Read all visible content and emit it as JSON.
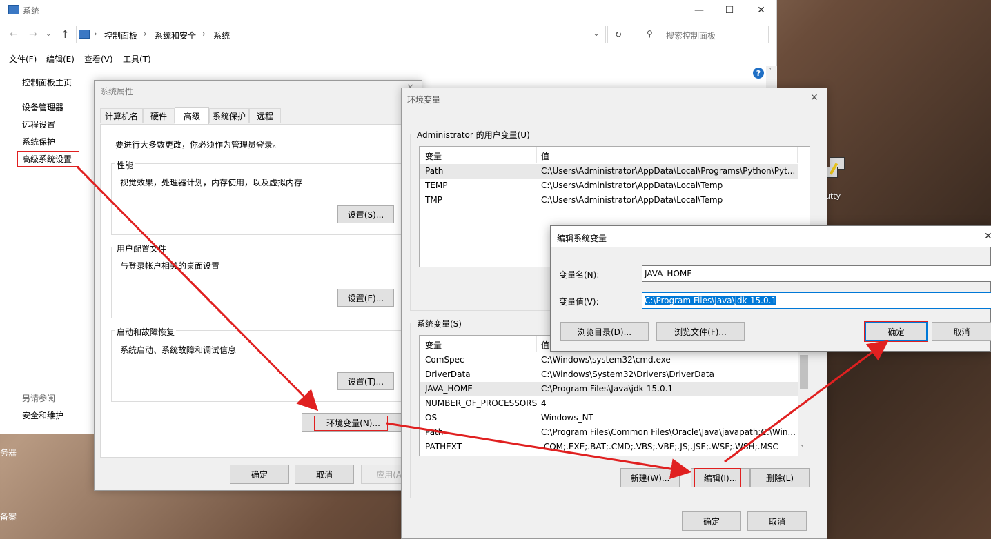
{
  "explorer": {
    "title": "系统",
    "breadcrumb": [
      "控制面板",
      "系统和安全",
      "系统"
    ],
    "search_placeholder": "搜索控制面板",
    "menu": [
      "文件(F)",
      "编辑(E)",
      "查看(V)",
      "工具(T)"
    ],
    "sidebar": {
      "home": "控制面板主页",
      "items": [
        "设备管理器",
        "远程设置",
        "系统保护",
        "高级系统设置"
      ],
      "see_also_title": "另请参阅",
      "see_also": [
        "安全和维护"
      ]
    }
  },
  "desktop": {
    "icon_label": "utty",
    "left_edge_text_1": "务器",
    "left_edge_text_2": "备案"
  },
  "sysprops": {
    "title": "系统属性",
    "tabs": [
      "计算机名",
      "硬件",
      "高级",
      "系统保护",
      "远程"
    ],
    "admin_note": "要进行大多数更改，你必须作为管理员登录。",
    "perf": {
      "title": "性能",
      "desc": "视觉效果，处理器计划，内存使用，以及虚拟内存",
      "button": "设置(S)..."
    },
    "profile": {
      "title": "用户配置文件",
      "desc": "与登录帐户相关的桌面设置",
      "button": "设置(E)..."
    },
    "startup": {
      "title": "启动和故障恢复",
      "desc": "系统启动、系统故障和调试信息",
      "button": "设置(T)..."
    },
    "env_button": "环境变量(N)...",
    "ok": "确定",
    "cancel": "取消",
    "apply": "应用(A)"
  },
  "envvars": {
    "title": "环境变量",
    "user_group": "Administrator 的用户变量(U)",
    "col_var": "变量",
    "col_val": "值",
    "user_vars": [
      {
        "name": "Path",
        "value": "C:\\Users\\Administrator\\AppData\\Local\\Programs\\Python\\Pyt..."
      },
      {
        "name": "TEMP",
        "value": "C:\\Users\\Administrator\\AppData\\Local\\Temp"
      },
      {
        "name": "TMP",
        "value": "C:\\Users\\Administrator\\AppData\\Local\\Temp"
      }
    ],
    "sys_group": "系统变量(S)",
    "sys_vars": [
      {
        "name": "ComSpec",
        "value": "C:\\Windows\\system32\\cmd.exe"
      },
      {
        "name": "DriverData",
        "value": "C:\\Windows\\System32\\Drivers\\DriverData"
      },
      {
        "name": "JAVA_HOME",
        "value": "C:\\Program Files\\Java\\jdk-15.0.1"
      },
      {
        "name": "NUMBER_OF_PROCESSORS",
        "value": "4"
      },
      {
        "name": "OS",
        "value": "Windows_NT"
      },
      {
        "name": "Path",
        "value": "C:\\Program Files\\Common Files\\Oracle\\Java\\javapath;C:\\Win..."
      },
      {
        "name": "PATHEXT",
        "value": ".COM;.EXE;.BAT;.CMD;.VBS;.VBE;.JS;.JSE;.WSF;.WSH;.MSC"
      }
    ],
    "new_button": "新建(W)...",
    "edit_button": "编辑(I)...",
    "delete_button": "删除(L)",
    "ok": "确定",
    "cancel": "取消"
  },
  "editvar": {
    "title": "编辑系统变量",
    "name_label": "变量名(N):",
    "name_value": "JAVA_HOME",
    "value_label": "变量值(V):",
    "value_value": "C:\\Program Files\\Java\\jdk-15.0.1",
    "browse_dir": "浏览目录(D)...",
    "browse_file": "浏览文件(F)...",
    "ok": "确定",
    "cancel": "取消"
  },
  "colors": {
    "annotation_red": "#e02020",
    "selection_blue": "#0078d7"
  }
}
